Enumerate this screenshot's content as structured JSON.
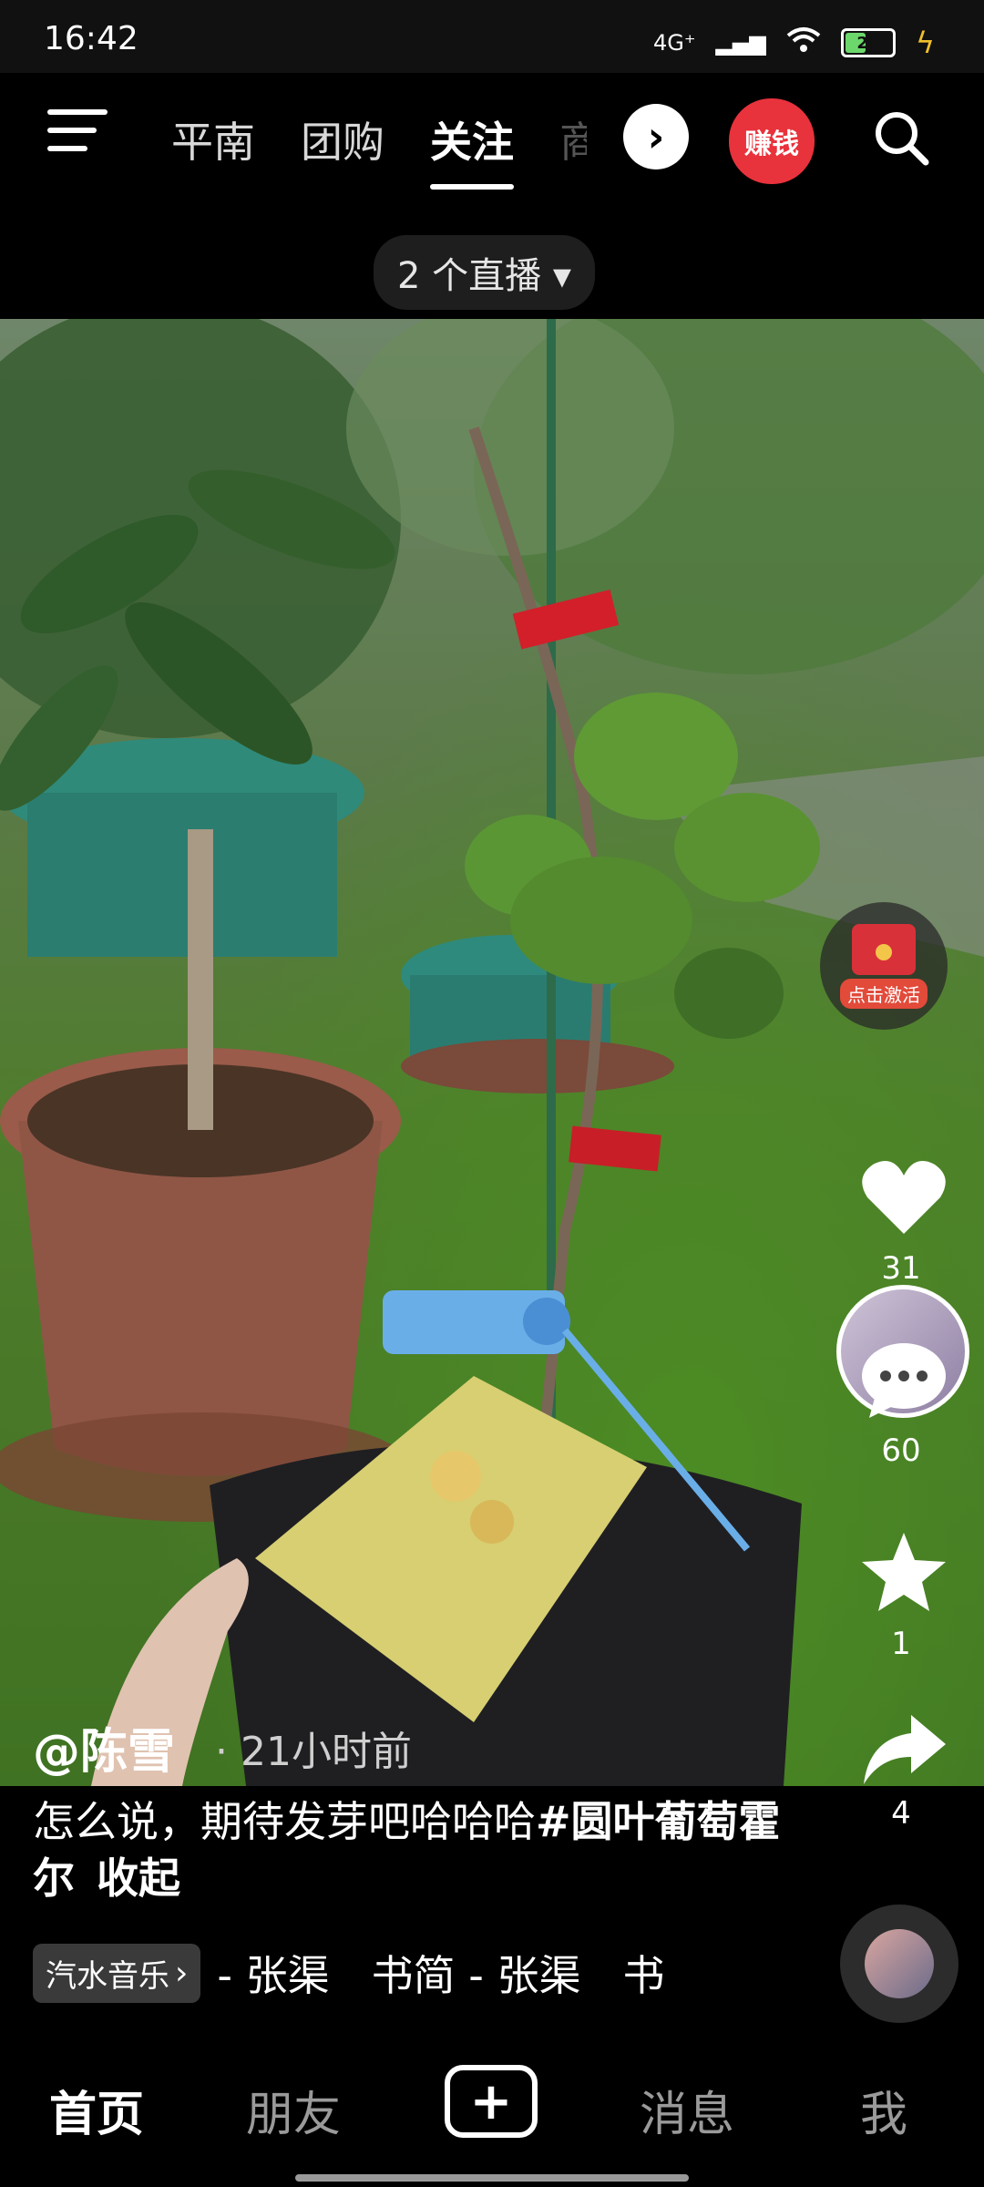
{
  "status_bar": {
    "time": "16:42",
    "network": "4G⁺",
    "battery_level": "24"
  },
  "top_nav": {
    "tabs": [
      {
        "label": "平南",
        "active": false
      },
      {
        "label": "团购",
        "active": false
      },
      {
        "label": "关注",
        "active": true
      },
      {
        "label": "商",
        "active": false
      }
    ],
    "earn_label": "赚钱"
  },
  "live_pill": "2 个直播 ▾",
  "video": {
    "badge_text": "点击激活",
    "actions": {
      "like_count": "31",
      "comment_count": "60",
      "favorite_count": "1",
      "share_count": "4"
    },
    "author": "@陈雪",
    "time_ago": "· 21小时前",
    "caption_text": "怎么说，期待发芽吧哈哈哈",
    "caption_hashtag": "#圆叶葡萄霍尔",
    "caption_collapse": "收起",
    "music_tag": "汽水音乐",
    "music_title": "- 张渠　书简 - 张渠　书"
  },
  "bottom_nav": {
    "home": "首页",
    "friends": "朋友",
    "messages": "消息",
    "me": "我"
  }
}
